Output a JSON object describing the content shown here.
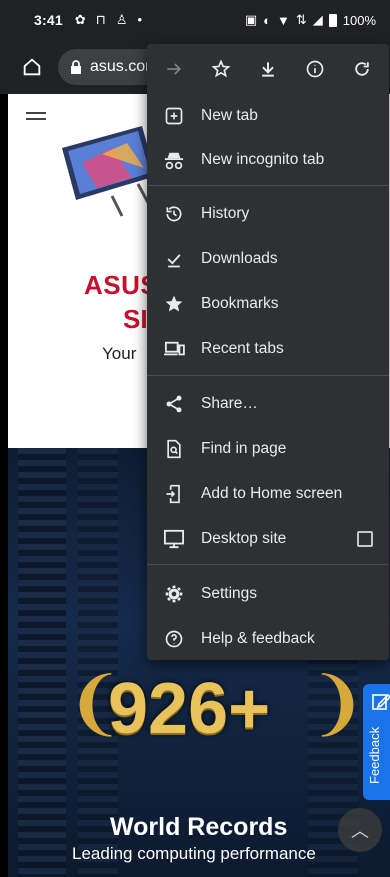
{
  "status_bar": {
    "time": "3:41",
    "battery": "100%",
    "left_icons": [
      "settings-icon",
      "notification-icon",
      "assistant-icon",
      "dot-icon"
    ],
    "right_icons": [
      "nfc-icon",
      "vibrate-icon",
      "wifi-icon",
      "data-icon",
      "signal-icon",
      "battery-icon"
    ]
  },
  "toolbar": {
    "url": "asus.com"
  },
  "menu": {
    "top_actions": [
      "forward-icon",
      "bookmark-star-icon",
      "download-icon",
      "info-icon",
      "reload-icon"
    ],
    "items": [
      {
        "label": "New tab",
        "icon": "plus-box-icon"
      },
      {
        "label": "New incognito tab",
        "icon": "incognito-icon"
      },
      {
        "label": "History",
        "icon": "history-icon"
      },
      {
        "label": "Downloads",
        "icon": "downloads-icon"
      },
      {
        "label": "Bookmarks",
        "icon": "star-icon"
      },
      {
        "label": "Recent tabs",
        "icon": "devices-icon"
      },
      {
        "label": "Share…",
        "icon": "share-icon"
      },
      {
        "label": "Find in page",
        "icon": "find-in-page-icon"
      },
      {
        "label": "Add to Home screen",
        "icon": "add-to-home-icon"
      },
      {
        "label": "Desktop site",
        "icon": "desktop-icon",
        "checked": false
      },
      {
        "label": "Settings",
        "icon": "gear-icon"
      },
      {
        "label": "Help & feedback",
        "icon": "help-icon"
      }
    ]
  },
  "page": {
    "hero_line1": "ASUS",
    "hero_line2": "SI",
    "hero_line3": "Your",
    "badge": "926+",
    "banner_title": "World Records",
    "banner_subtitle": "Leading computing performance",
    "feedback_label": "Feedback"
  },
  "colors": {
    "toolbar_bg": "#202124",
    "menu_bg": "#2f3033",
    "brand_red": "#c8102e",
    "feedback_blue": "#1a73e8"
  }
}
